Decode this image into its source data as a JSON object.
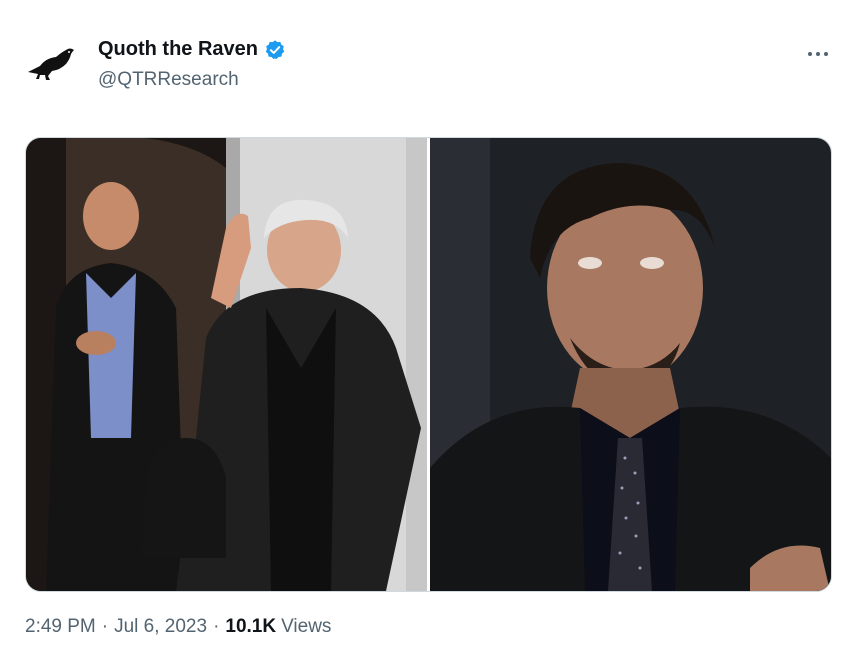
{
  "author": {
    "name": "Quoth the Raven",
    "handle": "@QTRResearch",
    "verified": true,
    "avatar_icon": "raven-icon",
    "verified_color": "#1d9bf0"
  },
  "tweet": {
    "time": "2:49 PM",
    "date": "Jul 6, 2023",
    "views_count": "10.1K",
    "views_label": "Views",
    "separator": "·"
  },
  "menu": {
    "icon": "more-icon"
  },
  "colors": {
    "secondary_text": "#536471",
    "primary_text": "#0f1419"
  }
}
